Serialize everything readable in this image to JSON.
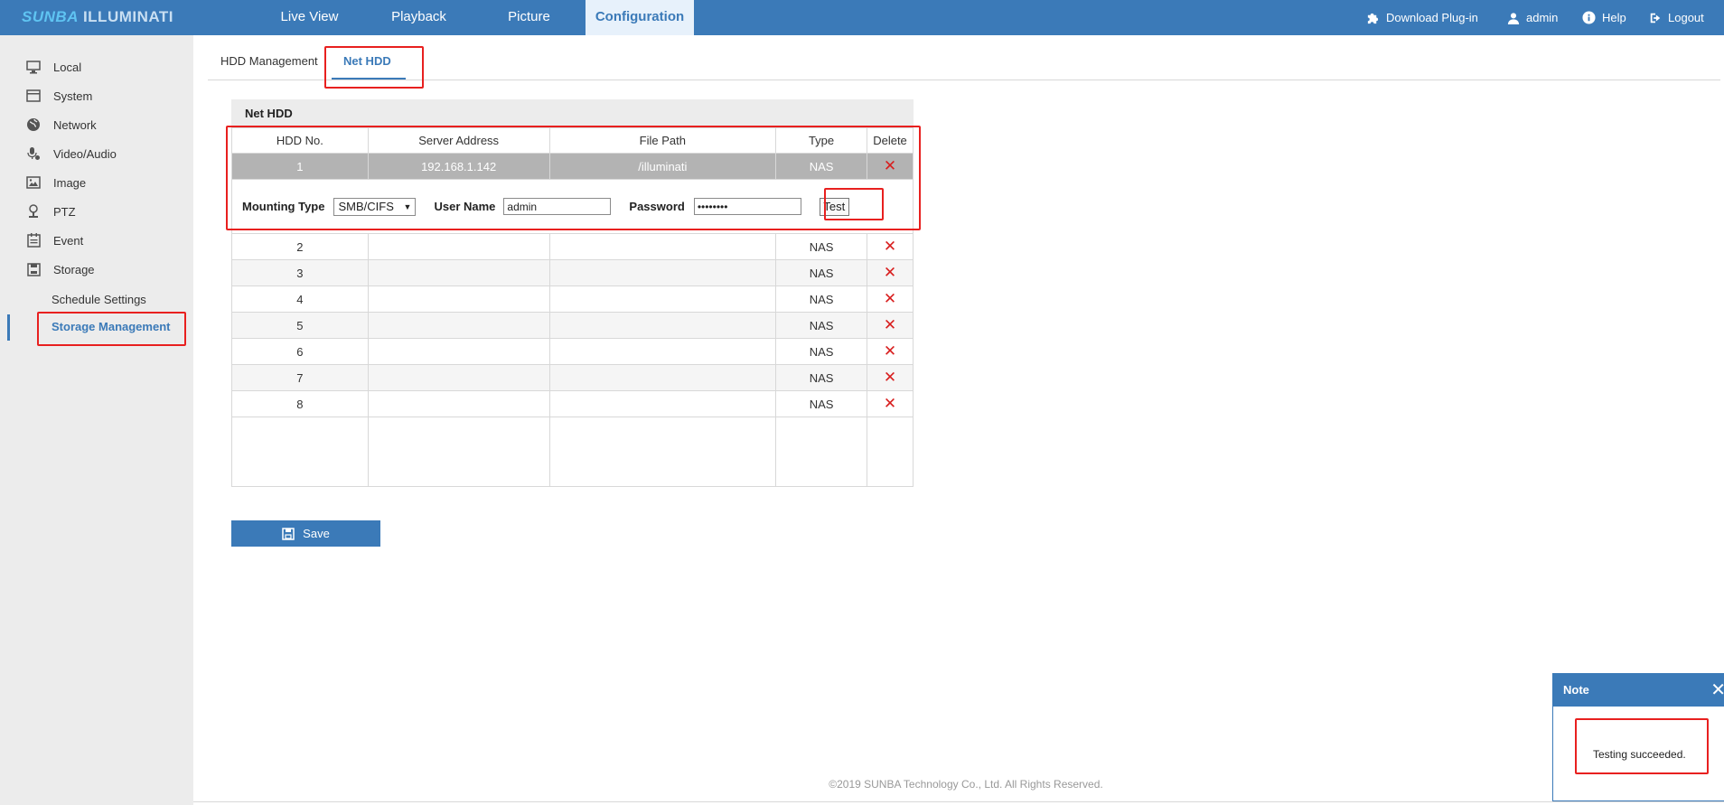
{
  "brand": {
    "part1": "SUNBA",
    "part2": "ILLUMINATI"
  },
  "nav": [
    {
      "label": "Live View"
    },
    {
      "label": "Playback"
    },
    {
      "label": "Picture"
    },
    {
      "label": "Configuration"
    }
  ],
  "top_right": {
    "plugin": "Download Plug-in",
    "user": "admin",
    "help": "Help",
    "logout": "Logout"
  },
  "sidebar": {
    "items": [
      {
        "label": "Local",
        "icon": "monitor-icon"
      },
      {
        "label": "System",
        "icon": "system-icon"
      },
      {
        "label": "Network",
        "icon": "globe-icon"
      },
      {
        "label": "Video/Audio",
        "icon": "microphone-icon"
      },
      {
        "label": "Image",
        "icon": "image-icon"
      },
      {
        "label": "PTZ",
        "icon": "ptz-icon"
      },
      {
        "label": "Event",
        "icon": "calendar-icon"
      },
      {
        "label": "Storage",
        "icon": "disk-icon"
      }
    ],
    "sub_items": [
      {
        "label": "Schedule Settings"
      },
      {
        "label": "Storage Management"
      }
    ]
  },
  "tabs": [
    {
      "label": "HDD Management"
    },
    {
      "label": "Net HDD"
    }
  ],
  "panel": {
    "title": "Net HDD",
    "columns": [
      "HDD No.",
      "Server Address",
      "File Path",
      "Type",
      "Delete"
    ],
    "rows": [
      {
        "no": "1",
        "address": "192.168.1.142",
        "path": "/illuminati",
        "type": "NAS"
      },
      {
        "no": "2",
        "address": "",
        "path": "",
        "type": "NAS"
      },
      {
        "no": "3",
        "address": "",
        "path": "",
        "type": "NAS"
      },
      {
        "no": "4",
        "address": "",
        "path": "",
        "type": "NAS"
      },
      {
        "no": "5",
        "address": "",
        "path": "",
        "type": "NAS"
      },
      {
        "no": "6",
        "address": "",
        "path": "",
        "type": "NAS"
      },
      {
        "no": "7",
        "address": "",
        "path": "",
        "type": "NAS"
      },
      {
        "no": "8",
        "address": "",
        "path": "",
        "type": "NAS"
      }
    ],
    "delete_glyph": "✕",
    "detail": {
      "mounting_type_label": "Mounting Type",
      "mounting_type_value": "SMB/CIFS",
      "user_name_label": "User Name",
      "user_name_value": "admin",
      "password_label": "Password",
      "password_value": "••••••••",
      "test_label": "Test"
    }
  },
  "save_label": "Save",
  "footer": "©2019 SUNBA Technology Co., Ltd. All Rights Reserved.",
  "note": {
    "title": "Note",
    "message": "Testing succeeded.",
    "close": "✕"
  },
  "colors": {
    "primary": "#3b7ab8",
    "highlight": "#e8201f",
    "delete": "#d81e1e",
    "selected_row": "#b3b3b3"
  }
}
